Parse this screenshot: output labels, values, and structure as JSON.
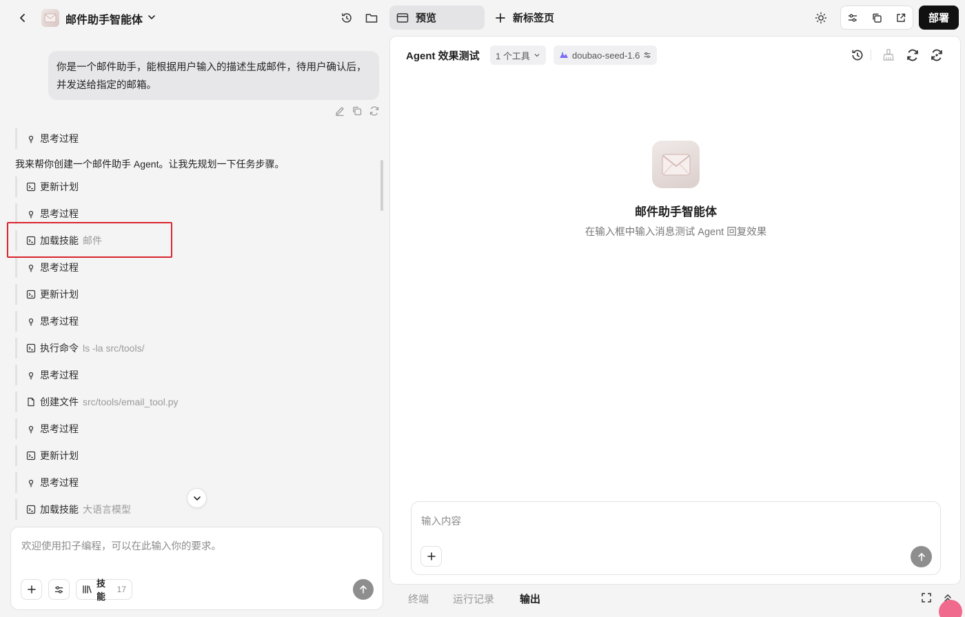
{
  "app": {
    "title": "邮件助手智能体"
  },
  "tabs": {
    "preview": "预览",
    "new_tab": "新标签页"
  },
  "deploy_label": "部署",
  "chat": {
    "user_message": "你是一个邮件助手，能根据用户输入的描述生成邮件，待用户确认后，并发送给指定的邮箱。",
    "assistant_text": "我来帮你创建一个邮件助手 Agent。让我先规划一下任务步骤。",
    "steps": [
      {
        "label": "思考过程",
        "sub": "",
        "icon": "lightbulb-icon"
      },
      {
        "label": "更新计划",
        "sub": "",
        "icon": "terminal-icon"
      },
      {
        "label": "思考过程",
        "sub": "",
        "icon": "lightbulb-icon"
      },
      {
        "label": "加载技能",
        "sub": "邮件",
        "icon": "terminal-icon"
      },
      {
        "label": "思考过程",
        "sub": "",
        "icon": "lightbulb-icon"
      },
      {
        "label": "更新计划",
        "sub": "",
        "icon": "terminal-icon"
      },
      {
        "label": "思考过程",
        "sub": "",
        "icon": "lightbulb-icon"
      },
      {
        "label": "执行命令",
        "sub": "ls -la src/tools/",
        "icon": "terminal-icon"
      },
      {
        "label": "思考过程",
        "sub": "",
        "icon": "lightbulb-icon"
      },
      {
        "label": "创建文件",
        "sub": "src/tools/email_tool.py",
        "icon": "file-icon"
      },
      {
        "label": "思考过程",
        "sub": "",
        "icon": "lightbulb-icon"
      },
      {
        "label": "更新计划",
        "sub": "",
        "icon": "terminal-icon"
      },
      {
        "label": "思考过程",
        "sub": "",
        "icon": "lightbulb-icon"
      },
      {
        "label": "加载技能",
        "sub": "大语言模型",
        "icon": "terminal-icon"
      }
    ]
  },
  "composer": {
    "placeholder": "欢迎使用扣子编程，可以在此输入你的要求。",
    "skills_label": "技能",
    "skills_count": "17"
  },
  "preview": {
    "title": "Agent 效果测试",
    "tools_chip": "1 个工具",
    "model_chip": "doubao-seed-1.6",
    "agent_name": "邮件助手智能体",
    "hint": "在输入框中输入消息测试 Agent 回复效果",
    "input_placeholder": "输入内容"
  },
  "bottom_tabs": [
    "终端",
    "运行记录",
    "输出"
  ],
  "colors": {
    "highlight": "#d9232d",
    "deploy_bg": "#111111",
    "send_bg": "#8e8e8e"
  }
}
